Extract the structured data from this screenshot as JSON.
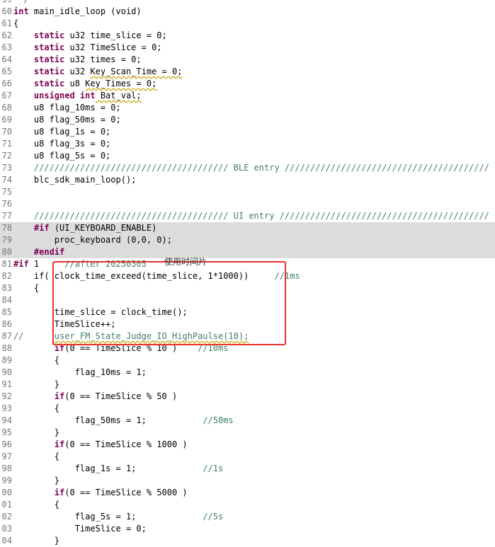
{
  "lines": [
    {
      "num": "59",
      "hl": false,
      "t": [
        {
          "s": "  /",
          "c": "cm"
        }
      ]
    },
    {
      "num": "60",
      "hl": false,
      "t": [
        {
          "s": "int",
          "c": "kw"
        },
        {
          "s": " main_idle_loop (void)",
          "c": ""
        }
      ]
    },
    {
      "num": "61",
      "hl": false,
      "t": [
        {
          "s": "{",
          "c": ""
        }
      ]
    },
    {
      "num": "62",
      "hl": false,
      "t": [
        {
          "s": "    ",
          "c": ""
        },
        {
          "s": "static",
          "c": "kw"
        },
        {
          "s": " u32 time_slice = 0;",
          "c": ""
        }
      ]
    },
    {
      "num": "63",
      "hl": false,
      "t": [
        {
          "s": "    ",
          "c": ""
        },
        {
          "s": "static",
          "c": "kw"
        },
        {
          "s": " u32 TimeSlice = 0;",
          "c": ""
        }
      ]
    },
    {
      "num": "64",
      "hl": false,
      "t": [
        {
          "s": "    ",
          "c": ""
        },
        {
          "s": "static",
          "c": "kw"
        },
        {
          "s": " u32 times = 0;",
          "c": ""
        }
      ]
    },
    {
      "num": "65",
      "hl": false,
      "t": [
        {
          "s": "    ",
          "c": ""
        },
        {
          "s": "static",
          "c": "kw"
        },
        {
          "s": " u32 ",
          "c": ""
        },
        {
          "s": "Key_Scan_Time = 0;",
          "c": "sq"
        }
      ]
    },
    {
      "num": "66",
      "hl": false,
      "t": [
        {
          "s": "    ",
          "c": ""
        },
        {
          "s": "static",
          "c": "kw"
        },
        {
          "s": " u8 ",
          "c": ""
        },
        {
          "s": "Key_Times = 0;",
          "c": "sq"
        }
      ]
    },
    {
      "num": "67",
      "hl": false,
      "t": [
        {
          "s": "    ",
          "c": ""
        },
        {
          "s": "unsigned int",
          "c": "kw"
        },
        {
          "s": " Bat_val;",
          "c": "sq"
        }
      ]
    },
    {
      "num": "68",
      "hl": false,
      "t": [
        {
          "s": "    u8 flag_10ms = 0;",
          "c": ""
        }
      ]
    },
    {
      "num": "69",
      "hl": false,
      "t": [
        {
          "s": "    u8 flag_50ms = 0;",
          "c": ""
        }
      ]
    },
    {
      "num": "70",
      "hl": false,
      "t": [
        {
          "s": "    u8 flag_1s = 0;",
          "c": ""
        }
      ]
    },
    {
      "num": "71",
      "hl": false,
      "t": [
        {
          "s": "    u8 flag_3s = 0;",
          "c": ""
        }
      ]
    },
    {
      "num": "72",
      "hl": false,
      "t": [
        {
          "s": "    u8 flag_5s = 0;",
          "c": ""
        }
      ]
    },
    {
      "num": "73",
      "hl": false,
      "t": [
        {
          "s": "    ////////////////////////////////////// BLE entry ////////////////////////////////////////",
          "c": "cm"
        }
      ]
    },
    {
      "num": "74",
      "hl": false,
      "t": [
        {
          "s": "    blc_sdk_main_loop();",
          "c": ""
        }
      ]
    },
    {
      "num": "75",
      "hl": false,
      "t": [
        {
          "s": "",
          "c": ""
        }
      ]
    },
    {
      "num": "76",
      "hl": false,
      "t": [
        {
          "s": "",
          "c": ""
        }
      ]
    },
    {
      "num": "77",
      "hl": false,
      "t": [
        {
          "s": "    ////////////////////////////////////// UI entry /////////////////////////////////////////",
          "c": "cm"
        }
      ]
    },
    {
      "num": "78",
      "hl": true,
      "t": [
        {
          "s": "    ",
          "c": ""
        },
        {
          "s": "#if",
          "c": "pp"
        },
        {
          "s": " (UI_KEYBOARD_ENABLE)",
          "c": ""
        }
      ]
    },
    {
      "num": "79",
      "hl": true,
      "t": [
        {
          "s": "        proc_keyboard (0,0, 0);",
          "c": ""
        }
      ]
    },
    {
      "num": "80",
      "hl": true,
      "t": [
        {
          "s": "    ",
          "c": ""
        },
        {
          "s": "#endif",
          "c": "pp"
        }
      ]
    },
    {
      "num": "81",
      "hl": false,
      "t": [
        {
          "s": "#if",
          "c": "pp"
        },
        {
          "s": " 1     ",
          "c": ""
        },
        {
          "s": "//after 20250305",
          "c": "cm"
        }
      ]
    },
    {
      "num": "82",
      "hl": false,
      "t": [
        {
          "s": "    if( clock_time_exceed(time_slice, 1*1000))     ",
          "c": ""
        },
        {
          "s": "//1ms",
          "c": "cm"
        }
      ]
    },
    {
      "num": "83",
      "hl": false,
      "t": [
        {
          "s": "    {",
          "c": ""
        }
      ]
    },
    {
      "num": "84",
      "hl": false,
      "t": [
        {
          "s": "",
          "c": ""
        }
      ]
    },
    {
      "num": "85",
      "hl": false,
      "t": [
        {
          "s": "        time_slice = clock_time();",
          "c": ""
        }
      ]
    },
    {
      "num": "86",
      "hl": false,
      "t": [
        {
          "s": "        TimeSlice++;",
          "c": ""
        }
      ]
    },
    {
      "num": "87",
      "hl": false,
      "t": [
        {
          "s": "//      ",
          "c": "cm"
        },
        {
          "s": "user_FM_State_Judge_IO_HighPaulse(10);",
          "c": "cm sq"
        }
      ]
    },
    {
      "num": "88",
      "hl": false,
      "t": [
        {
          "s": "        ",
          "c": ""
        },
        {
          "s": "if",
          "c": "kw"
        },
        {
          "s": "(0 == TimeSlice % 10 )    ",
          "c": ""
        },
        {
          "s": "//10ms",
          "c": "cm"
        }
      ]
    },
    {
      "num": "89",
      "hl": false,
      "t": [
        {
          "s": "        {",
          "c": ""
        }
      ]
    },
    {
      "num": "90",
      "hl": false,
      "t": [
        {
          "s": "            flag_10ms = 1;",
          "c": ""
        }
      ]
    },
    {
      "num": "91",
      "hl": false,
      "t": [
        {
          "s": "        }",
          "c": ""
        }
      ]
    },
    {
      "num": "92",
      "hl": false,
      "t": [
        {
          "s": "        ",
          "c": ""
        },
        {
          "s": "if",
          "c": "kw"
        },
        {
          "s": "(0 == TimeSlice % 50 )",
          "c": ""
        }
      ]
    },
    {
      "num": "93",
      "hl": false,
      "t": [
        {
          "s": "        {",
          "c": ""
        }
      ]
    },
    {
      "num": "94",
      "hl": false,
      "t": [
        {
          "s": "            flag_50ms = 1;           ",
          "c": ""
        },
        {
          "s": "//50ms",
          "c": "cm"
        }
      ]
    },
    {
      "num": "95",
      "hl": false,
      "t": [
        {
          "s": "        }",
          "c": ""
        }
      ]
    },
    {
      "num": "96",
      "hl": false,
      "t": [
        {
          "s": "        ",
          "c": ""
        },
        {
          "s": "if",
          "c": "kw"
        },
        {
          "s": "(0 == TimeSlice % 1000 )",
          "c": ""
        }
      ]
    },
    {
      "num": "97",
      "hl": false,
      "t": [
        {
          "s": "        {",
          "c": ""
        }
      ]
    },
    {
      "num": "98",
      "hl": false,
      "t": [
        {
          "s": "            flag_1s = 1;             ",
          "c": ""
        },
        {
          "s": "//1s",
          "c": "cm"
        }
      ]
    },
    {
      "num": "99",
      "hl": false,
      "t": [
        {
          "s": "        }",
          "c": ""
        }
      ]
    },
    {
      "num": "100",
      "hl": false,
      "t": [
        {
          "s": "        ",
          "c": ""
        },
        {
          "s": "if",
          "c": "kw"
        },
        {
          "s": "(0 == TimeSlice % 5000 )",
          "c": ""
        }
      ]
    },
    {
      "num": "101",
      "hl": false,
      "t": [
        {
          "s": "        {",
          "c": ""
        }
      ]
    },
    {
      "num": "102",
      "hl": false,
      "t": [
        {
          "s": "            flag_5s = 1;             ",
          "c": ""
        },
        {
          "s": "//5s",
          "c": "cm"
        }
      ]
    },
    {
      "num": "103",
      "hl": false,
      "t": [
        {
          "s": "            TimeSlice = 0;",
          "c": ""
        }
      ]
    },
    {
      "num": "104",
      "hl": false,
      "t": [
        {
          "s": "        }",
          "c": ""
        }
      ]
    }
  ],
  "annotation": {
    "label": "使用时间片",
    "color": "#e8302a"
  },
  "colors": {
    "keyword": "#7f0055",
    "comment": "#3f7f5f",
    "highlight": "#dcdcdc",
    "gutter": "#787878"
  }
}
